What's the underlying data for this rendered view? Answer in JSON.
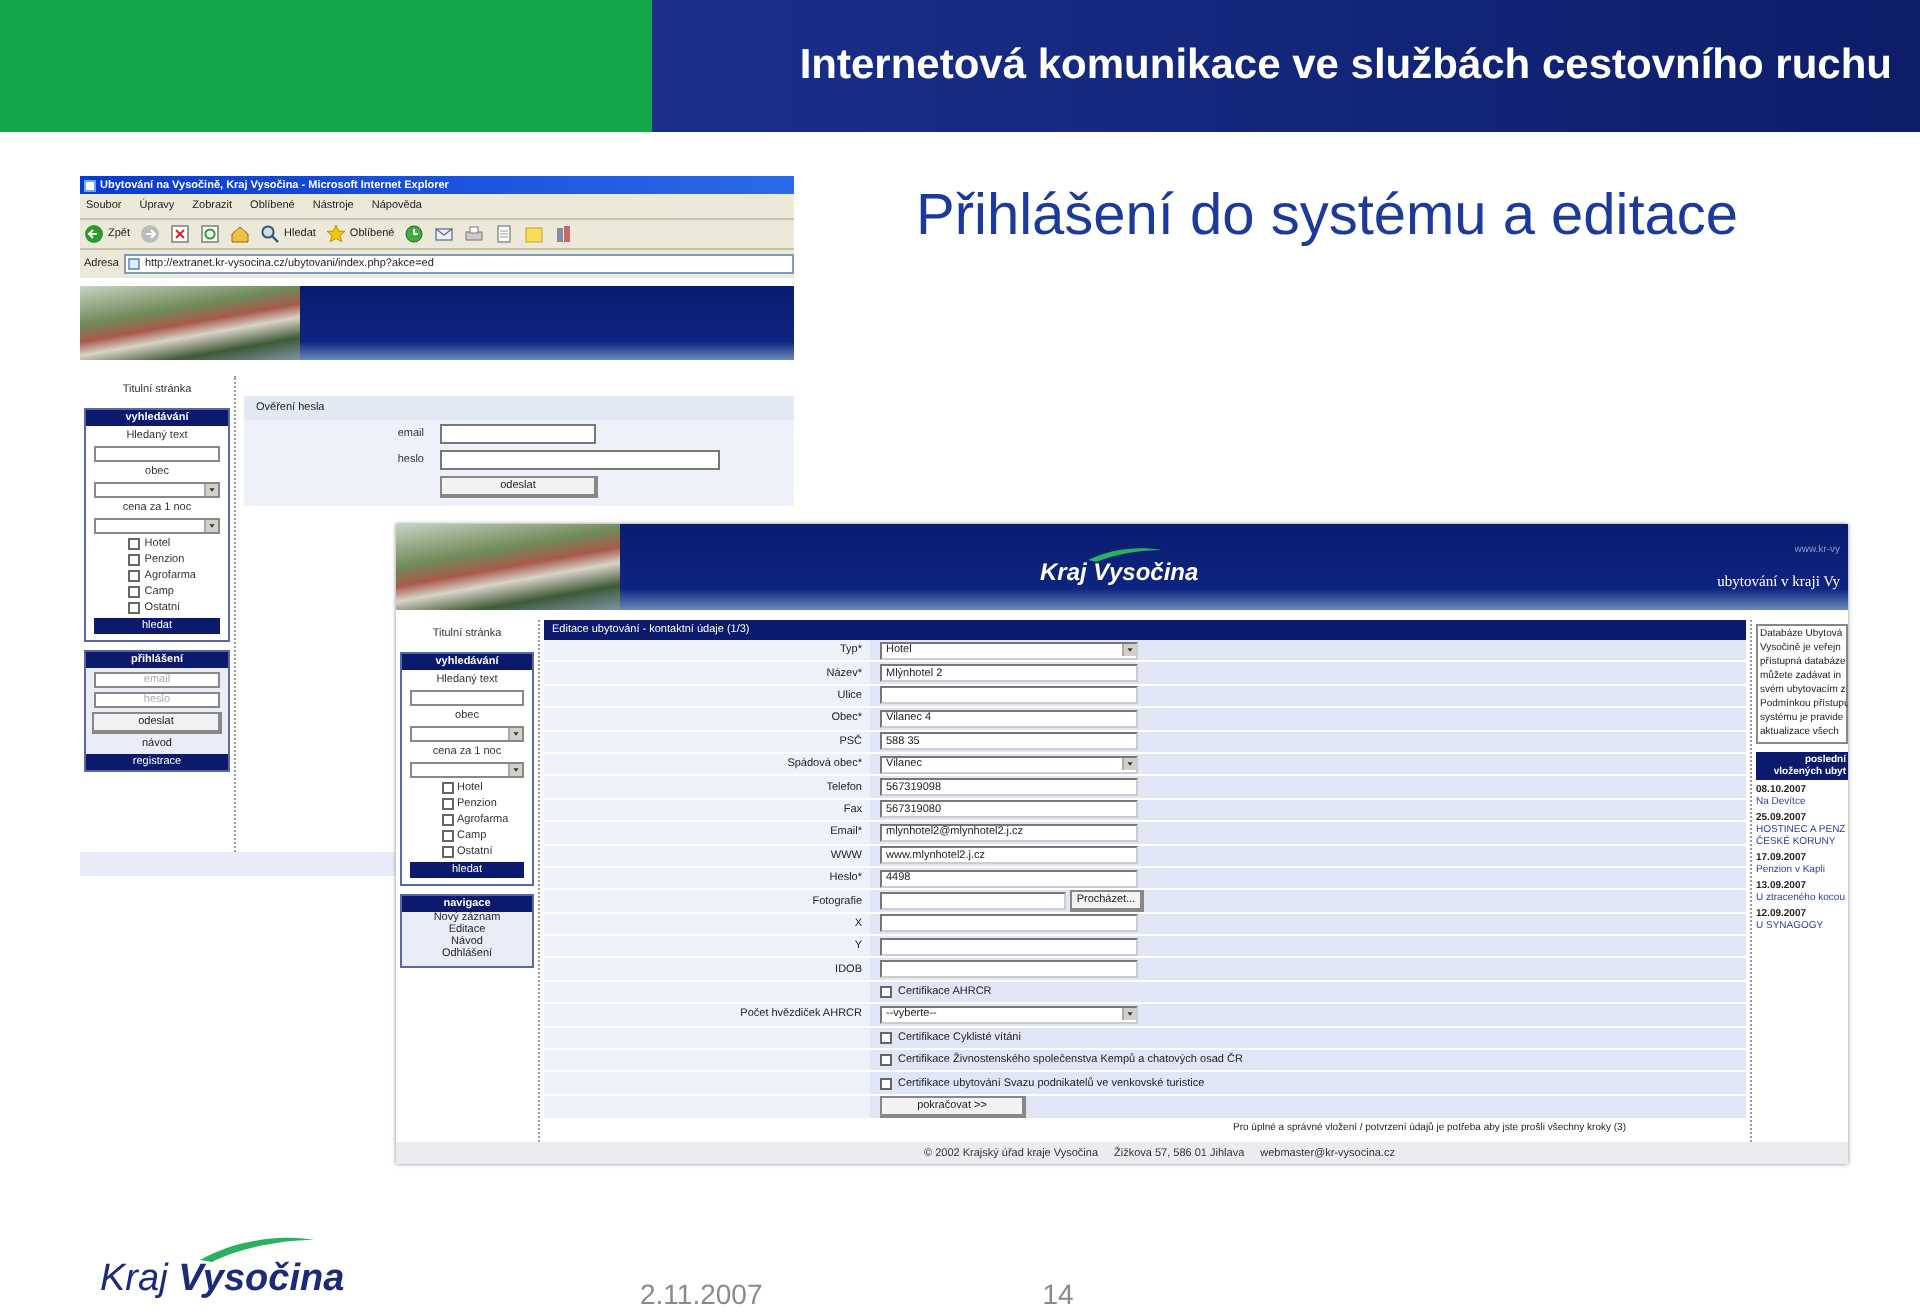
{
  "slide": {
    "header_title": "Internetová komunikace ve službách cestovního ruchu",
    "title": "Přihlášení do systému a editace",
    "logo": "Kraj **Vysočina**",
    "date": "2.11.2007",
    "page_number": "14"
  },
  "browser": {
    "title": "Ubytování na Vysočině, Kraj Vysočina - Microsoft Internet Explorer",
    "menu": [
      "Soubor",
      "Úpravy",
      "Zobrazit",
      "Oblíbené",
      "Nástroje",
      "Nápověda"
    ],
    "toolbar_labels": [
      "Zpět",
      "Hledat",
      "Oblíbené"
    ],
    "address_label": "Adresa",
    "address": "http://extranet.kr-vysocina.cz/ubytovani/index.php?akce=ed",
    "sidebar": {
      "home": "Titulní stránka",
      "search": {
        "title": "vyhledávání",
        "text_label": "Hledaný text",
        "town_label": "obec",
        "price_label": "cena za 1 noc",
        "button": "hledat",
        "types": [
          {
            "label": "Hotel",
            "checked": false
          },
          {
            "label": "Penzion",
            "checked": false
          },
          {
            "label": "Agrofarma",
            "checked": false
          },
          {
            "label": "Camp",
            "checked": false
          },
          {
            "label": "Ostatní",
            "checked": false
          }
        ]
      }
    },
    "login": {
      "title": "přihlášení",
      "email_placeholder": "email",
      "password_placeholder": "heslo",
      "submit": "odeslat",
      "guide": "návod",
      "register": "registrace"
    },
    "main": {
      "title": "Ověření hesla",
      "fields": [
        {
          "label": "email"
        },
        {
          "label": "heslo"
        }
      ],
      "submit": "odeslat"
    }
  },
  "edit_page": {
    "banner": {
      "logo": "Kraj Vysočina",
      "url": "www.kr-vy",
      "slogan": "ubytování v kraji Vy"
    },
    "sidebar": {
      "home": "Titulní stránka",
      "search": {
        "title": "vyhledávání",
        "text_label": "Hledaný text",
        "town_label": "obec",
        "price_label": "cena za 1 noc",
        "button": "hledat",
        "types": [
          {
            "label": "Hotel",
            "checked": false
          },
          {
            "label": "Penzion",
            "checked": false
          },
          {
            "label": "Agrofarma",
            "checked": false
          },
          {
            "label": "Camp",
            "checked": false
          },
          {
            "label": "Ostatní",
            "checked": false
          }
        ]
      }
    },
    "navigation": {
      "title": "navigace",
      "items": [
        "Nový záznam",
        "Editace",
        "Návod",
        "Odhlášení"
      ]
    },
    "form": {
      "title": "Editace ubytování - kontaktní údaje (1/3)",
      "rows": [
        {
          "kind": "select",
          "label": "Typ*",
          "value": "Hotel"
        },
        {
          "kind": "text",
          "label": "Název*",
          "value": "Mlýnhotel 2"
        },
        {
          "kind": "text",
          "label": "Ulice"
        },
        {
          "kind": "text",
          "label": "Obec*",
          "value": "Vilanec 4"
        },
        {
          "kind": "text",
          "label": "PSČ",
          "value": "588 35"
        },
        {
          "kind": "select",
          "label": "Spádová obec*",
          "value": "Vilanec"
        },
        {
          "kind": "text",
          "label": "Telefon",
          "value": "567319098"
        },
        {
          "kind": "text",
          "label": "Fax",
          "value": "567319080"
        },
        {
          "kind": "text",
          "label": "Email*",
          "value": "mlynhotel2@mlynhotel2.j.cz"
        },
        {
          "kind": "text",
          "label": "WWW",
          "value": "www.mlynhotel2.j.cz"
        },
        {
          "kind": "text",
          "label": "Heslo*",
          "value": "4498"
        },
        {
          "kind": "file",
          "label": "Fotografie",
          "button": "Procházet..."
        },
        {
          "kind": "text",
          "label": "X"
        },
        {
          "kind": "text",
          "label": "Y"
        },
        {
          "kind": "text",
          "label": "IDOB"
        },
        {
          "kind": "checkbox",
          "text": "Certifikace AHRCR",
          "checked": false
        },
        {
          "kind": "select",
          "label": "Počet hvězdiček AHRCR",
          "value": "--vyberte--"
        },
        {
          "kind": "checkbox",
          "text": "Certifikace Cyklisté vítáni",
          "checked": false
        },
        {
          "kind": "checkbox",
          "text": "Certifikace Živnostenského společenstva Kempů a chatových osad ČR",
          "checked": false
        },
        {
          "kind": "checkbox",
          "text": "Certifikace ubytování Svazu podnikatelů ve venkovské turistice",
          "checked": false
        },
        {
          "kind": "button",
          "text": "pokračovat >>"
        }
      ],
      "note": "Pro úplné a správné vložení / potvrzení údajů je potřeba aby jste prošli všechny kroky (3)"
    },
    "info_lines": [
      "Databáze Ubytová",
      "Vysočině je veřejn",
      "přístupná databáze",
      "můžete zadávat in",
      "svém ubytovacím z",
      "Podmínkou přístupu",
      "systému je pravide",
      "aktualizace všech"
    ],
    "latest": {
      "title_lines": [
        "poslední",
        "vložených ubyt"
      ],
      "items": [
        {
          "date": "08.10.2007",
          "name_lines": [
            "Na Devítce"
          ]
        },
        {
          "date": "25.09.2007",
          "name_lines": [
            "HOSTINEC A PENZ",
            "ČESKÉ KORUNY"
          ]
        },
        {
          "date": "17.09.2007",
          "name_lines": [
            "Penzion v Kapli"
          ]
        },
        {
          "date": "13.09.2007",
          "name_lines": [
            "U ztraceného kocou"
          ]
        },
        {
          "date": "12.09.2007",
          "name_lines": [
            "U SYNAGOGY"
          ]
        }
      ]
    },
    "footer": [
      "© 2002 Krajský úřad kraje Vysočina",
      "Žižkova 57, 586 01 Jihlava",
      "webmaster@kr-vysocina.cz"
    ]
  }
}
